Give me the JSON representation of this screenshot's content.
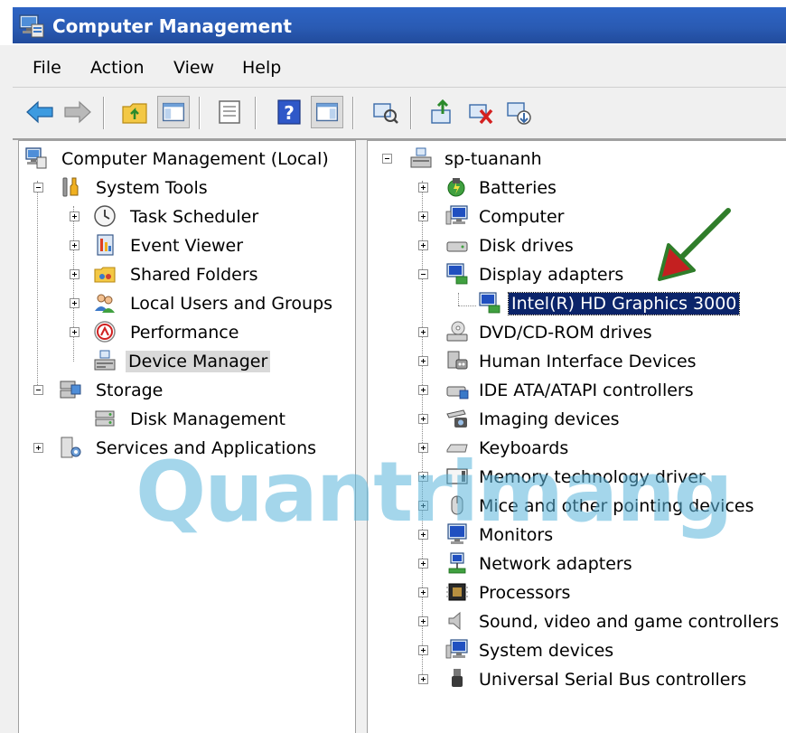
{
  "window": {
    "title": "Computer Management"
  },
  "menu": {
    "file": "File",
    "action": "Action",
    "view": "View",
    "help": "Help"
  },
  "toolbar": {
    "icons": [
      "back-arrow-icon",
      "forward-arrow-icon",
      "up-folder-icon",
      "show-hide-console-tree-icon",
      "properties-icon",
      "help-icon",
      "show-hide-action-pane-icon",
      "scan-hardware-icon",
      "update-driver-icon",
      "uninstall-icon",
      "disable-device-icon"
    ]
  },
  "left_tree": {
    "root": "Computer Management (Local)",
    "system_tools": "System Tools",
    "task_scheduler": "Task Scheduler",
    "event_viewer": "Event Viewer",
    "shared_folders": "Shared Folders",
    "local_users": "Local Users and Groups",
    "performance": "Performance",
    "device_manager": "Device Manager",
    "storage": "Storage",
    "disk_management": "Disk Management",
    "services": "Services and Applications"
  },
  "right_tree": {
    "root": "sp-tuananh",
    "items": [
      "Batteries",
      "Computer",
      "Disk drives",
      "Display adapters",
      "Intel(R) HD Graphics 3000",
      "DVD/CD-ROM drives",
      "Human Interface Devices",
      "IDE ATA/ATAPI controllers",
      "Imaging devices",
      "Keyboards",
      "Memory technology driver",
      "Mice and other pointing devices",
      "Monitors",
      "Network adapters",
      "Processors",
      "Sound, video and game controllers",
      "System devices",
      "Universal Serial Bus controllers"
    ]
  },
  "watermark": "Quantrimang",
  "colors": {
    "title_bar": "#2a5bb4",
    "selection_blue": "#0b246a",
    "selection_gray": "#d9d9d9",
    "arrow_green": "#2f7d2a",
    "arrow_red": "#c42020",
    "watermark": "#5bb6dc"
  }
}
